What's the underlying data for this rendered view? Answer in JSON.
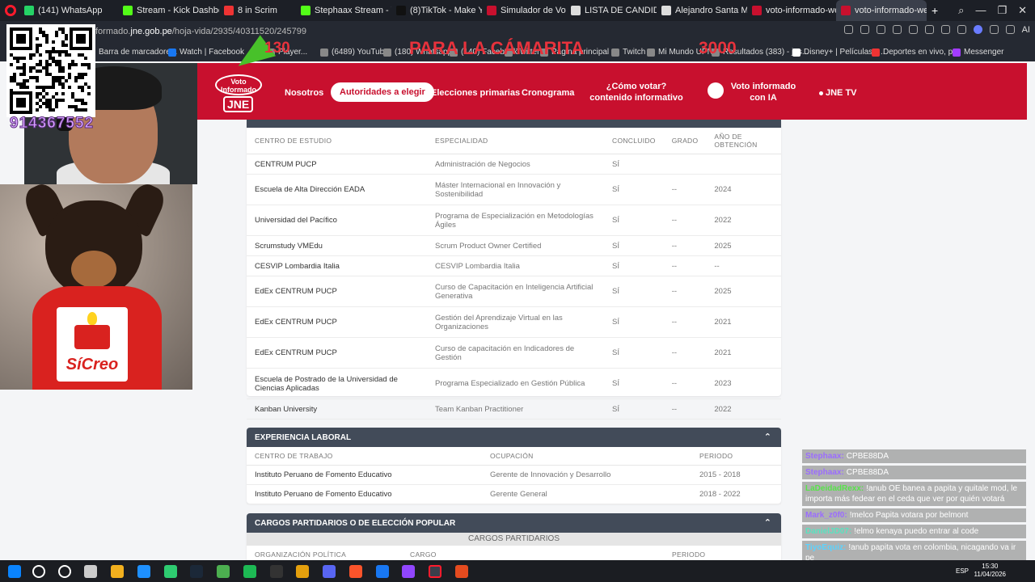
{
  "browser": {
    "tabs": [
      {
        "label": "(141) WhatsApp",
        "color": "#25d366"
      },
      {
        "label": "Stream - Kick Dashboard",
        "color": "#53fc18"
      },
      {
        "label": "8 in Scrim",
        "color": "#e33"
      },
      {
        "label": "Stephaax Stream - Watch",
        "color": "#53fc18"
      },
      {
        "label": "(8)TikTok - Make Your Day",
        "color": "#111"
      },
      {
        "label": "Simulador de Votación - I",
        "color": "#c8102e"
      },
      {
        "label": "LISTA DE CANDIDATOS -",
        "color": "#ddd"
      },
      {
        "label": "Alejandro Santa María - W",
        "color": "#ddd"
      },
      {
        "label": "voto-informado-web",
        "color": "#c8102e"
      },
      {
        "label": "voto-informado-web",
        "color": "#c8102e"
      }
    ],
    "url_prefix": "formado.",
    "url_domain": "jne.gob.pe",
    "url_path": "/hoja-vida/2935/40311520/245799",
    "bookmarks": [
      {
        "label": "Barra de marcadore...",
        "color": "#888"
      },
      {
        "label": "Watch | Facebook",
        "color": "#1877f2"
      },
      {
        "label": "Player...",
        "color": "#888"
      },
      {
        "label": "(6489) YouTube",
        "color": "#888"
      },
      {
        "label": "(180) Whatsapp",
        "color": "#888"
      },
      {
        "label": "(140) Facebook",
        "color": "#888"
      },
      {
        "label": "Twitter",
        "color": "#888"
      },
      {
        "label": "Página principal",
        "color": "#888"
      },
      {
        "label": "Twitch",
        "color": "#888"
      },
      {
        "label": "Mi Mundo UPN",
        "color": "#888"
      },
      {
        "label": "Resultados (383) - jes...",
        "color": "#888"
      },
      {
        "label": "Disney+ | Películas y...",
        "color": "#fff"
      },
      {
        "label": "Deportes en vivo, p...",
        "color": "#e33"
      },
      {
        "label": "Messenger",
        "color": "#a33cff"
      }
    ],
    "ai_label": "AI"
  },
  "site": {
    "logo_top": "Voto Informado",
    "logo_jne": "JNE",
    "nav": {
      "nosotros": "Nosotros",
      "autoridades": "Autoridades a elegir",
      "primarias": "Elecciones primarias",
      "cronograma": "Cronograma",
      "como_votar": "¿Cómo votar? contenido informativo",
      "voto_ia": "Voto informado con IA",
      "jne_tv": "JNE TV"
    }
  },
  "estudios": {
    "headers": {
      "centro": "CENTRO DE ESTUDIO",
      "especialidad": "ESPECIALIDAD",
      "concluido": "CONCLUIDO",
      "grado": "GRADO",
      "anio": "AÑO DE OBTENCIÓN"
    },
    "rows": [
      {
        "centro": "CENTRUM PUCP",
        "especialidad": "Administración de Negocios",
        "concluido": "SÍ",
        "grado": "",
        "anio": ""
      },
      {
        "centro": "Escuela de Alta Dirección EADA",
        "especialidad": "Máster Internacional en Innovación y Sostenibilidad",
        "concluido": "SÍ",
        "grado": "--",
        "anio": "2024"
      },
      {
        "centro": "Universidad del Pacífico",
        "especialidad": "Programa de Especialización en Metodologías Ágiles",
        "concluido": "SÍ",
        "grado": "--",
        "anio": "2022"
      },
      {
        "centro": "Scrumstudy VMEdu",
        "especialidad": "Scrum Product Owner Certified",
        "concluido": "SÍ",
        "grado": "--",
        "anio": "2025"
      },
      {
        "centro": "CESVIP Lombardia Italia",
        "especialidad": "CESVIP Lombardia Italia",
        "concluido": "SÍ",
        "grado": "--",
        "anio": "--"
      },
      {
        "centro": "EdEx CENTRUM PUCP",
        "especialidad": "Curso de Capacitación en Inteligencia Artificial Generativa",
        "concluido": "SÍ",
        "grado": "--",
        "anio": "2025"
      },
      {
        "centro": "EdEx CENTRUM PUCP",
        "especialidad": "Gestión del Aprendizaje Virtual en las Organizaciones",
        "concluido": "SÍ",
        "grado": "--",
        "anio": "2021"
      },
      {
        "centro": "EdEx CENTRUM PUCP",
        "especialidad": "Curso de capacitación en Indicadores de Gestión",
        "concluido": "SÍ",
        "grado": "--",
        "anio": "2021"
      },
      {
        "centro": "Escuela de Postrado de la Universidad de Ciencias Aplicadas",
        "especialidad": "Programa Especializado en Gestión Pública",
        "concluido": "SÍ",
        "grado": "--",
        "anio": "2023"
      },
      {
        "centro": "Kanban University",
        "especialidad": "Team Kanban Practitioner",
        "concluido": "SÍ",
        "grado": "--",
        "anio": "2022"
      }
    ]
  },
  "experiencia": {
    "title": "EXPERIENCIA LABORAL",
    "headers": {
      "centro": "CENTRO DE TRABAJO",
      "ocupacion": "OCUPACIÓN",
      "periodo": "PERIODO"
    },
    "rows": [
      {
        "centro": "Instituto Peruano de Fomento Educativo",
        "ocupacion": "Gerente de Innovación y Desarrollo",
        "periodo": "2015 - 2018"
      },
      {
        "centro": "Instituto Peruano de Fomento Educativo",
        "ocupacion": "Gerente General",
        "periodo": "2018 - 2022"
      }
    ]
  },
  "cargos": {
    "title": "CARGOS PARTIDARIOS O DE ELECCIÓN POPULAR",
    "subtitle": "CARGOS PARTIDARIOS",
    "headers": {
      "org": "ORGANIZACIÓN POLÍTICA",
      "cargo": "CARGO",
      "periodo": "PERIODO"
    }
  },
  "overlay": {
    "phone": "914367552",
    "promo": "PARA LA CÁMARITA",
    "num_left": "130",
    "num_right": "3000",
    "shirt_text": "SíCreo"
  },
  "chat": [
    {
      "user": "Stephaax:",
      "text": "CPBE88DA",
      "color": "#9b6cff"
    },
    {
      "user": "Stephaax:",
      "text": "CPBE88DA",
      "color": "#9b6cff"
    },
    {
      "user": "LaDeidadRexx:",
      "text": "!anub OE banea a papita y quitale mod, le importa más fedear en el ceda que ver por quién votará",
      "color": "#58e34b"
    },
    {
      "user": "Mark_z0f0:",
      "text": "!melco Papita votara por belmont",
      "color": "#9b6cff"
    },
    {
      "user": "DanielJD07:",
      "text": "!elmo kenaya puedo entrar al code",
      "color": "#58e3c0"
    },
    {
      "user": "TiyoEquiz:",
      "text": "!anub papita vota en colombia, nicagando va ir pe",
      "color": "#5ad3ff"
    }
  ],
  "taskbar": {
    "lang": "ESP",
    "time": "15:30",
    "date": "11/04/2026"
  },
  "colors": {
    "jne_red": "#c8102e",
    "card_header": "#424b59"
  }
}
